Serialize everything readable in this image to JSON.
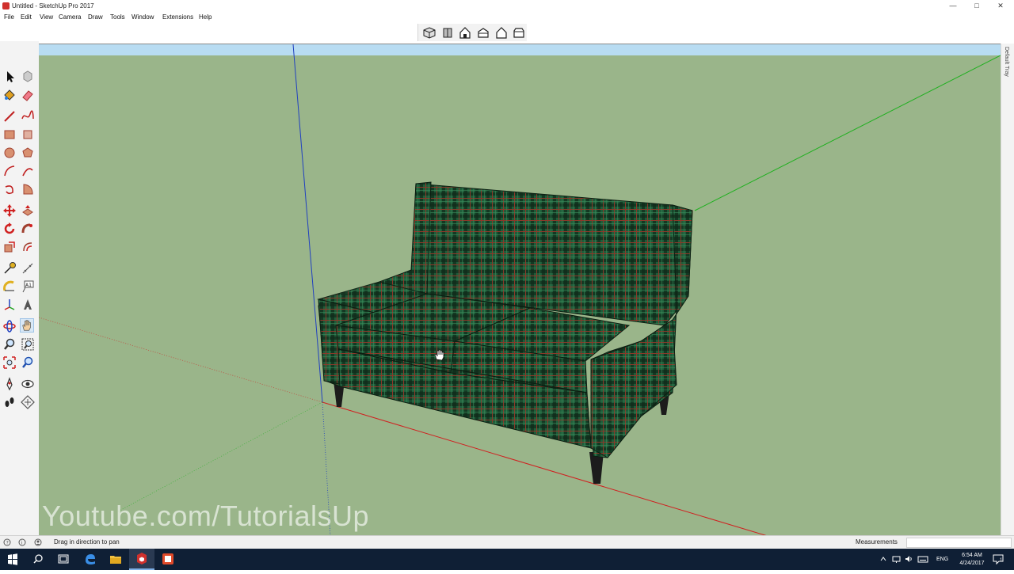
{
  "window": {
    "title": "Untitled - SketchUp Pro 2017",
    "icons": [
      "sketchup-icon",
      "minimize-icon",
      "maximize-icon",
      "close-icon"
    ]
  },
  "menubar": {
    "items": [
      "File",
      "Edit",
      "View",
      "Camera",
      "Draw",
      "Tools",
      "Window",
      "Extensions",
      "Help"
    ]
  },
  "views_toolbar": {
    "icons": [
      "iso-view-icon",
      "top-view-icon",
      "front-view-icon",
      "right-view-icon",
      "back-view-icon",
      "left-view-icon"
    ]
  },
  "left_toolbar": {
    "icons": [
      "select-icon",
      "make-component-icon",
      "paint-bucket-icon",
      "eraser-icon",
      "line-icon",
      "freehand-icon",
      "rectangle-icon",
      "rotated-rectangle-icon",
      "circle-icon",
      "polygon-icon",
      "arc-icon",
      "two-point-arc-icon",
      "three-point-arc-icon",
      "pie-icon",
      "move-icon",
      "push-pull-icon",
      "rotate-icon",
      "follow-me-icon",
      "scale-icon",
      "offset-icon",
      "tape-measure-icon",
      "dimension-icon",
      "protractor-icon",
      "text-icon",
      "axes-icon",
      "3d-text-icon",
      "orbit-icon",
      "pan-icon",
      "zoom-icon",
      "zoom-window-icon",
      "zoom-extents-icon",
      "previous-view-icon",
      "position-camera-icon",
      "look-around-icon",
      "walk-icon",
      "section-plane-icon"
    ],
    "active_tool": "pan-icon"
  },
  "viewport": {
    "watermark": "Youtube.com/TutorialsUp",
    "colors": {
      "sky": "#b8dcf2",
      "ground": "#9ab58a",
      "fabric": "#1f5d3a",
      "plaid_dark": "#0f2a1a",
      "plaid_red": "#8a3a2a",
      "legs": "#1c1c1c",
      "axis_red": "#d02020",
      "axis_green": "#20b020",
      "axis_blue": "#2040c0"
    }
  },
  "right_tray": {
    "label": "Default Tray"
  },
  "statusbar": {
    "text": "Drag in direction to pan",
    "measurements_label": "Measurements",
    "measurements_value": "",
    "icons": [
      "info-icon",
      "credits-icon",
      "user-icon"
    ]
  },
  "taskbar": {
    "icons": [
      "windows-start-icon",
      "search-icon",
      "task-view-icon",
      "edge-icon",
      "file-explorer-icon",
      "sketchup-icon",
      "layout-icon"
    ],
    "tray_icons": [
      "chevron-up-icon",
      "network-icon",
      "volume-icon",
      "keyboard-icon",
      "notifications-icon"
    ],
    "language": "ENG",
    "time": "6:54 AM",
    "date": "4/24/2017",
    "notification_count": "1"
  }
}
